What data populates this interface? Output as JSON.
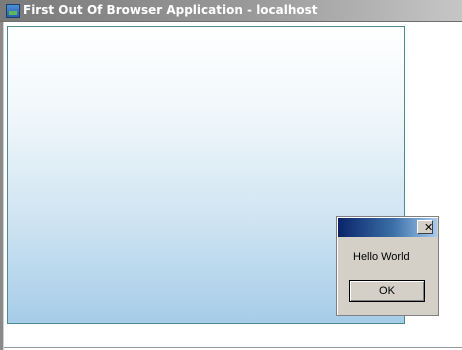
{
  "window": {
    "title": "First Out Of Browser Application - localhost",
    "icon": "app-icon"
  },
  "dialog": {
    "close_glyph": "✕",
    "message": "Hello World",
    "ok_label": "OK"
  },
  "colors": {
    "titlebar_inactive": "#7a7a7a",
    "dialog_title_start": "#0a246a",
    "dialog_title_end": "#a6caf0",
    "content_top": "#ffffff",
    "content_bottom": "#a6cce8",
    "dialog_face": "#d4d0c8"
  }
}
